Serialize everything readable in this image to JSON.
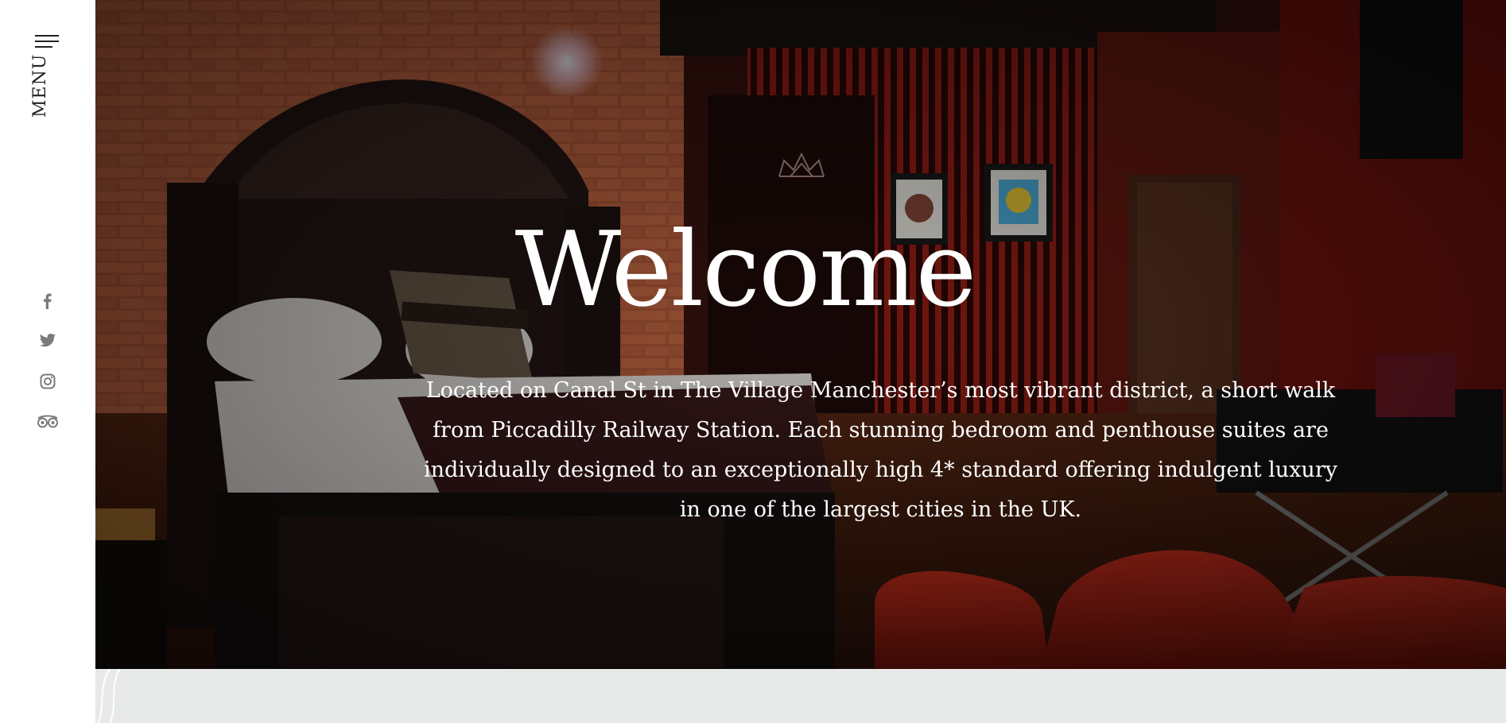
{
  "sidebar": {
    "menu_label": "MENU",
    "social_icons": [
      "facebook-icon",
      "twitter-icon",
      "instagram-icon",
      "tripadvisor-icon"
    ]
  },
  "hero": {
    "title": "Welcome",
    "description": "Located on Canal St in The Village Manchester’s most vibrant district, a short walk from Piccadilly Railway Station. Each stunning bedroom and penthouse suites are individually designed to an exceptionally high 4* standard offering indulgent luxury in one of the largest cities in the UK."
  },
  "colors": {
    "sidebar_bg": "#ffffff",
    "icon_grey": "#7b7b7b",
    "text_white": "#ffffff",
    "band_grey": "#e8eaea",
    "wall_red": "#8a1a14"
  }
}
